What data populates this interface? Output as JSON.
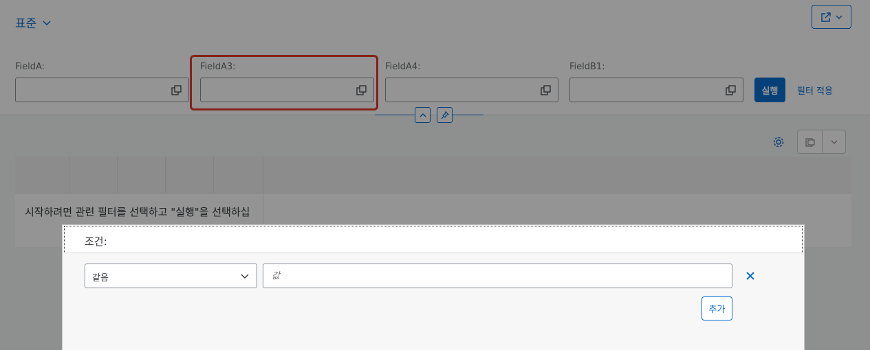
{
  "header": {
    "variant_title": "표준",
    "share_icon": "share-icon"
  },
  "filters": [
    {
      "label": "FieldA:",
      "value": "",
      "icon": "value-help-icon"
    },
    {
      "label": "FieldA3:",
      "value": "",
      "icon": "value-help-icon"
    },
    {
      "label": "FieldA4:",
      "value": "",
      "icon": "value-help-icon"
    },
    {
      "label": "FieldB1:",
      "value": "",
      "icon": "value-help-icon"
    }
  ],
  "filterbar": {
    "go_label": "실행",
    "adapt_label": "필터 적용"
  },
  "table": {
    "no_data_text": "시작하려면 관련 필터를 선택하고 \"실행\"을 선택하십"
  },
  "dialog": {
    "title": "조건:",
    "operator": "같음",
    "value_placeholder": "값",
    "add_label": "추가"
  },
  "colors": {
    "accent": "#0a6ed1",
    "highlight": "#e53a2c"
  }
}
